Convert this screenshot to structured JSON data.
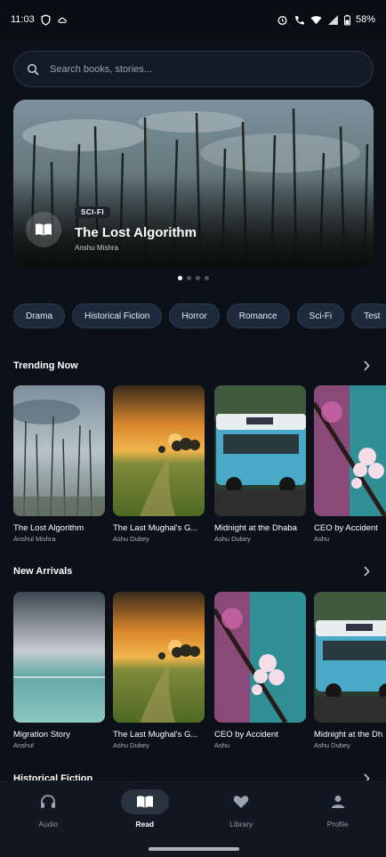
{
  "status_bar": {
    "time": "11:03",
    "battery": "58%"
  },
  "search": {
    "placeholder": "Search books, stories..."
  },
  "hero": {
    "tag": "SCI-FI",
    "title": "The Lost Algorithm",
    "author": "Anshu Mishra",
    "slide": 1,
    "slide_count": 4
  },
  "chips": [
    "Drama",
    "Historical Fiction",
    "Horror",
    "Romance",
    "Sci-Fi",
    "Test"
  ],
  "trending": {
    "title": "Trending Now",
    "books": [
      {
        "title": "The Lost Algorithm",
        "author": "Anshul Mishra"
      },
      {
        "title": "The Last Mughal's G...",
        "author": "Ashu Dubey"
      },
      {
        "title": "Midnight at the Dhaba",
        "author": "Ashu Dubey"
      },
      {
        "title": "CEO by Accident",
        "author": "Ashu"
      }
    ]
  },
  "new_arrivals": {
    "title": "New Arrivals",
    "books": [
      {
        "title": "Migration Story",
        "author": "Anshul"
      },
      {
        "title": "The Last Mughal's G...",
        "author": "Ashu Dubey"
      },
      {
        "title": "CEO by Accident",
        "author": "Ashu"
      },
      {
        "title": "Midnight at the Dh",
        "author": "Ashu Dubey"
      }
    ]
  },
  "historical": {
    "title": "Historical Fiction"
  },
  "nav": [
    {
      "label": "Audio",
      "icon": "headphones-icon"
    },
    {
      "label": "Read",
      "icon": "book-open-icon",
      "active": true
    },
    {
      "label": "Library",
      "icon": "heart-icon"
    },
    {
      "label": "Profile",
      "icon": "person-icon"
    }
  ]
}
